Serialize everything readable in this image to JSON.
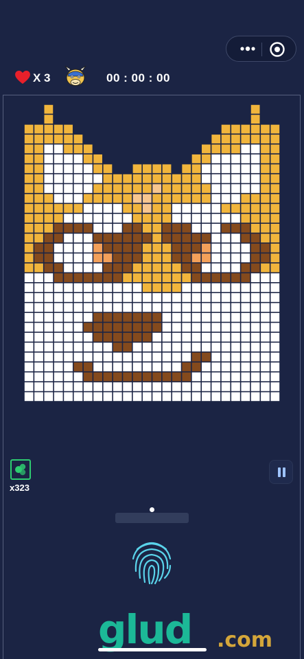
{
  "capsule": {
    "more_icon": "more-dots-icon",
    "close_icon": "target-circle-icon"
  },
  "hud": {
    "lives_text": "X 3",
    "timer_text": "00 : 00 : 00",
    "heart_color": "#e8202b",
    "mascot_icon": "cartoon-cow-mascot-icon"
  },
  "puzzle": {
    "cols": 26,
    "rows": 30,
    "palette": {
      "Y": "#f1b53c",
      "W": "#ffffff",
      "B": "#844a1d",
      "P": "#f3a05a",
      "L": "#f7c68f",
      "O": "#e88d3c"
    },
    "grid": [
      "..Y....................Y..",
      "..Y....................Y..",
      "YYYYY...............YYYYYY",
      "YYYYYY.............YYYYYYY",
      "YYWWYYY...........YYYYWWYY",
      "YYWWWWYY.........YYWWWWWYY",
      "YYWWWWWYY..YYYY.YYWWWWWWYY",
      "YYWWWWWWYYYYYYYYYYWWWWWWYY",
      "YYWWWWWYYYYYYLYYYYYWWWWWYY",
      "YYYWWWYYYYYLLYYYYYYWWWYYYY",
      "YYYYYYWWWWYYLYYWWWWWYYYYYY",
      "YYYYWWWWWWWYYYYWWWWWWWYYYY",
      "YYYBBBBWWWBBYYBBBWWWBBBYYY",
      "YYBBWWWBBBBBBYBBBBBWWWBBYY",
      "YBBWWWWPBBBBYYYBBBPWWWWBBY",
      "YBBWWWWPPBBBYYYBBPPWWWWBBY",
      "YYBBWWWWBBBYYYYYBBWWWWBBYY",
      "WWWBBBBBBBYYYYYYYBBBBBBWWW",
      "WWWWWWWWWWWWYYYYWWWWWWWWWW",
      "WWWWWWWWWWWWWWWWWWWWWWWWWW",
      "WWWWWWWWWWWWWWWWWWWWWWWWWW",
      "WWWWWWWBBBBBBBWWWWWWWWWWWW",
      "WWWWWWBBBBBBBBWWWWWWWWWWWW",
      "WWWWWWWBBBBBBWWWWWWWWWWWWW",
      "WWWWWWWWWBBWWWWWWWWWWWWWWW",
      "WWWWWWWWWWWWWWWWWBBWWWWWWW",
      "WWWWWBBWWWWWWWWWBBWWWWWWWW",
      "WWWWWWBBBBBBBBBBBWWWWWWWWW",
      "WWWWWWWWWWWWWWWWWWWWWWWWWW",
      "WWWWWWWWWWWWWWWWWWWWWWWWWW"
    ]
  },
  "hint": {
    "count_text": "x323",
    "accent": "#2ecc71"
  },
  "controls": {
    "pause_icon": "pause-icon",
    "fingerprint_icon": "fingerprint-icon"
  },
  "watermark": {
    "main": "glud",
    "suffix": ".com"
  }
}
